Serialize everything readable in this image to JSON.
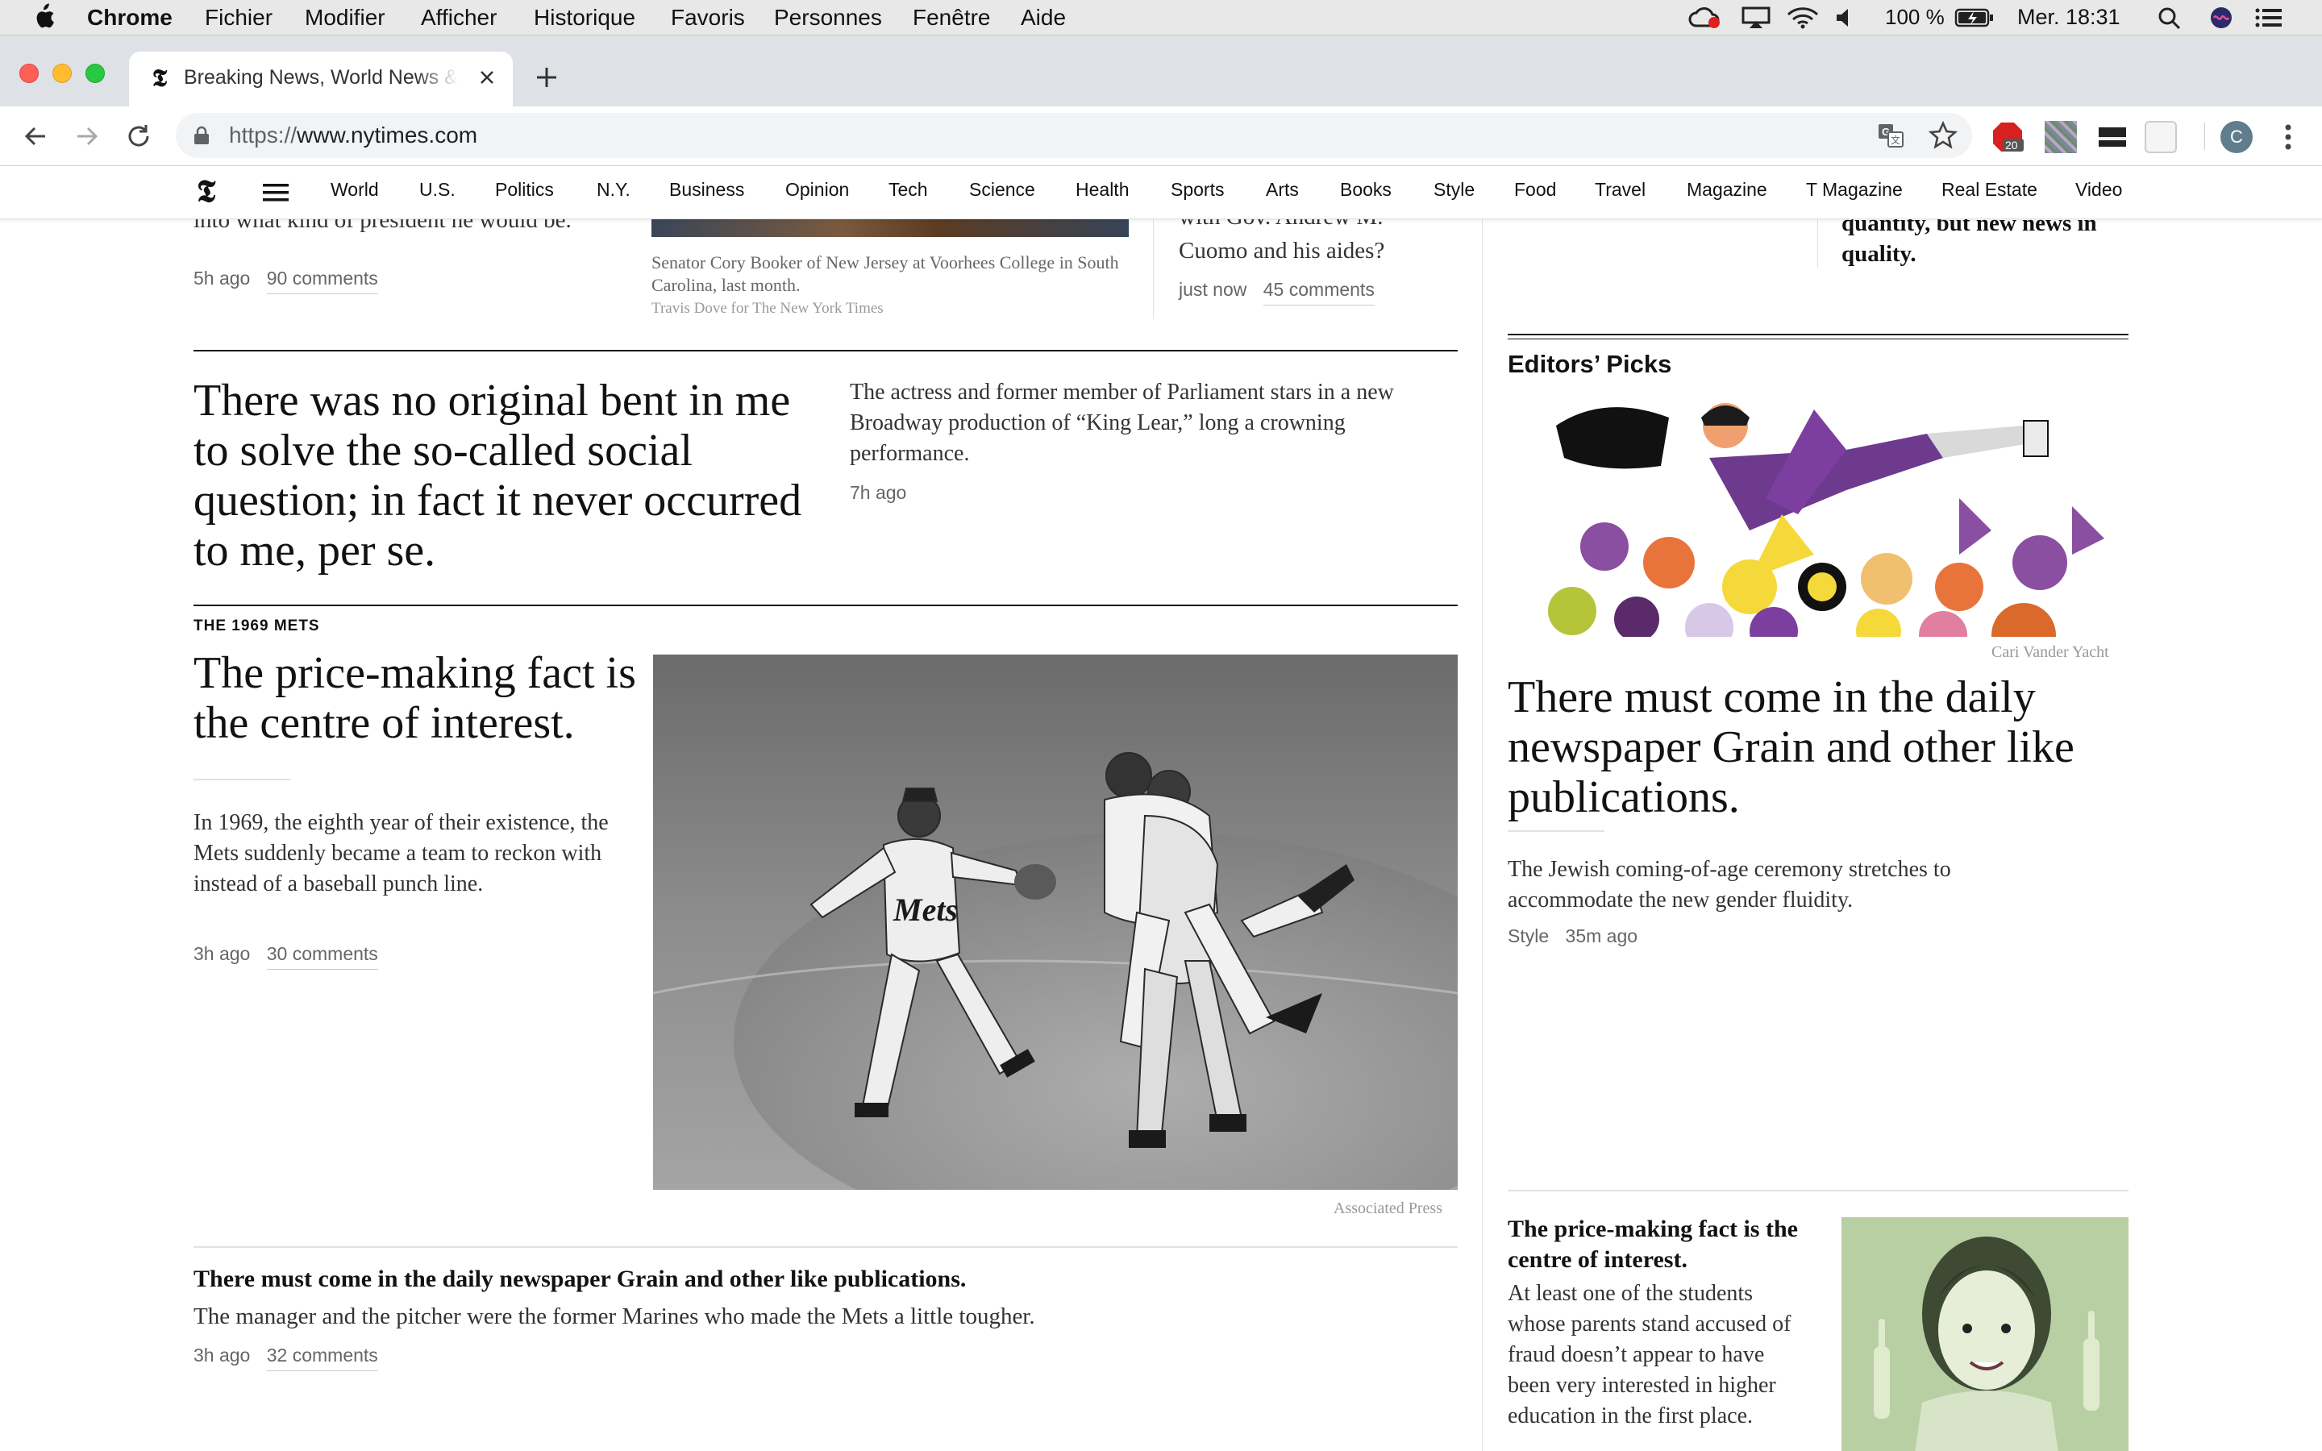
{
  "menubar": {
    "app": "Chrome",
    "items": [
      "Fichier",
      "Modifier",
      "Afficher",
      "Historique",
      "Favoris",
      "Personnes",
      "Fenêtre",
      "Aide"
    ],
    "battery": "100 %",
    "clock": "Mer. 18:31"
  },
  "browser": {
    "tab_title": "Breaking News, World News & Multimedia",
    "url_scheme": "https://",
    "url_host": "www.nytimes.com",
    "extension_badge": "20",
    "profile_initial": "C"
  },
  "nyt": {
    "logo": "𝕿",
    "sections": [
      "World",
      "U.S.",
      "Politics",
      "N.Y.",
      "Business",
      "Opinion",
      "Tech",
      "Science",
      "Health",
      "Sports",
      "Arts",
      "Books",
      "Style",
      "Food",
      "Travel",
      "Magazine",
      "T Magazine",
      "Real Estate",
      "Video"
    ]
  },
  "top_partial": {
    "left_text": "into what kind of president he would be.",
    "left_meta_time": "5h ago",
    "left_meta_comments": "90 comments",
    "caption": "Senator Cory Booker of New Jersey at Voorhees College in South Carolina, last month.",
    "credit": "Travis Dove for The New York Times",
    "right_text_line1": "with Gov. Andrew M.",
    "right_text_line2": "Cuomo and his aides?",
    "right_meta_time": "just now",
    "right_meta_comments": "45 comments"
  },
  "story_lear": {
    "headline": "There was no original bent in me to solve the so-called social question; in fact it never occurred to me, per se.",
    "summary": "The actress and former member of Parliament stars in a new Broadway production of “King Lear,” long a crowning performance.",
    "time": "7h ago"
  },
  "story_mets": {
    "kicker": "THE 1969 METS",
    "headline": "The price-making fact is the centre of interest.",
    "summary": "In 1969, the eighth year of their existence, the Mets suddenly became a team to reckon with instead of a baseball punch line.",
    "time": "3h ago",
    "comments": "30 comments",
    "photo_credit": "Associated Press",
    "jersey_text": "Mets"
  },
  "story_marines": {
    "headline": "There must come in the daily newspaper Grain and other like publications.",
    "summary": "The manager and the pitcher were the former Marines who made the Mets a little tougher.",
    "time": "3h ago",
    "comments": "32 comments"
  },
  "sidebar": {
    "top_partial_line1": "quantity, but new news in",
    "top_partial_line2": "quality.",
    "editors_picks_title": "Editors’ Picks",
    "illustration_credit": "Cari Vander Yacht",
    "pick1_headline": "There must come in the daily newspaper Grain and other like publications.",
    "pick1_summary": "The Jewish coming-of-age ceremony stretches to accommodate the new gender fluidity.",
    "pick1_section": "Style",
    "pick1_time": "35m ago",
    "pick2_headline": "The price-making fact is the centre of interest.",
    "pick2_summary": "At least one of the students whose parents stand accused of fraud doesn’t appear to have been very interested in higher education in the first place."
  }
}
